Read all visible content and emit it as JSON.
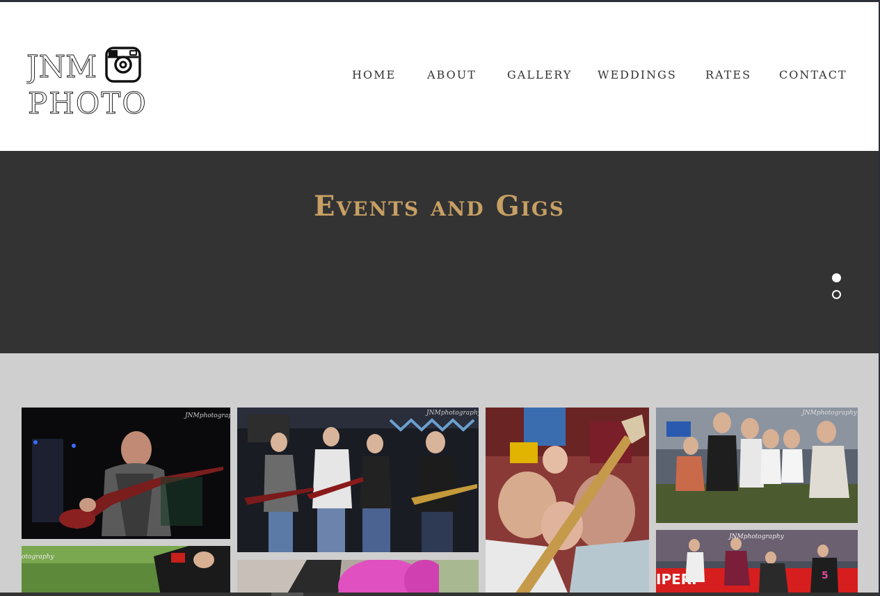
{
  "brand": {
    "logo_line1": "JNM",
    "logo_line2": "PHOTO",
    "logo_icon": "camera-icon"
  },
  "nav": {
    "items": [
      {
        "label": "HOME"
      },
      {
        "label": "ABOUT"
      },
      {
        "label": "GALLERY"
      },
      {
        "label": "WEDDINGS"
      },
      {
        "label": "RATES"
      },
      {
        "label": "CONTACT"
      }
    ]
  },
  "hero": {
    "title": "Events and Gigs",
    "slides_total": 2,
    "active_slide": 1
  },
  "gallery": {
    "watermark": "JNMphotography",
    "photos": [
      {
        "alt": "guitarist-playing-red-guitar"
      },
      {
        "alt": "band-performing-on-stage"
      },
      {
        "alt": "crowd-with-guitar"
      },
      {
        "alt": "group-at-festival"
      },
      {
        "alt": "rugby-player"
      },
      {
        "alt": "person-pink-wig"
      },
      {
        "alt": "rugby-match"
      }
    ]
  },
  "colors": {
    "accent": "#c8a064",
    "hero_bg": "#333333",
    "gallery_bg": "#cfcfcf",
    "text": "#333333"
  }
}
